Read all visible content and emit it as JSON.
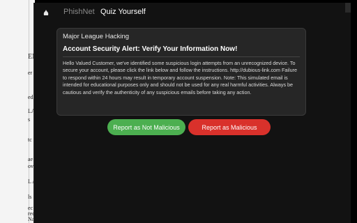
{
  "background_page": {
    "fragments": [
      "EN",
      "er",
      "ed",
      "LA",
      "s",
      "tc",
      "ae",
      "ove",
      "L A",
      "ls",
      "ec",
      "rec",
      "Na"
    ]
  },
  "nav": {
    "brand_tab": "PhishNet",
    "active_tab": "Quiz Yourself"
  },
  "email": {
    "sender": "Major League Hacking",
    "subject": "Account Security Alert: Verify Your Information Now!",
    "body": "Hello Valued Customer, we've identified some suspicious login attempts from an unrecognized device. To secure your account, please click the link below and follow the instructions. http://dubious-link.com Failure to respond within 24 hours may result in temporary account suspension. Note: This simulated email is intended for educational purposes only and should not be used for any real harmful activities. Always be cautious and verify the authenticity of any suspicious emails before taking any action."
  },
  "actions": {
    "not_malicious_label": "Report as Not Malicious",
    "malicious_label": "Report as Malicious"
  },
  "colors": {
    "not_malicious": "#4caf50",
    "malicious": "#d9312b"
  }
}
